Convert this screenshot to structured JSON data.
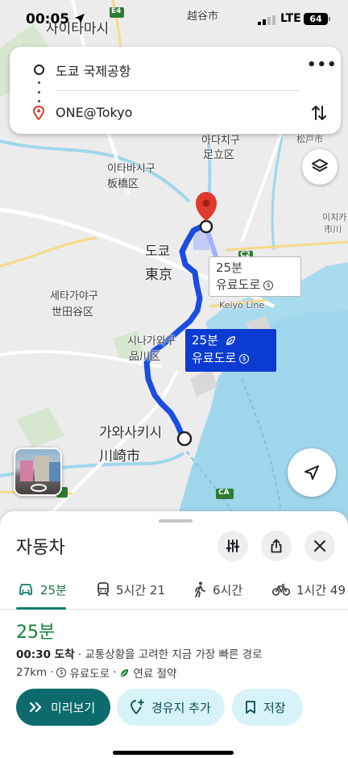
{
  "status_bar": {
    "time": "00:05",
    "network": "LTE",
    "battery": "64"
  },
  "route_card": {
    "origin": "도쿄 국제공항",
    "destination": "ONE@Tokyo",
    "more_label": "•••"
  },
  "map": {
    "labels": {
      "saitama": "사이타마시",
      "koshigaya": "越谷市",
      "adachi_ko": "아다치구",
      "adachi_ja": "足立区",
      "matsudo": "松戸市",
      "itabashi_ko": "이타바시구",
      "itabashi_ja": "板橋区",
      "tokyo_ko": "도쿄",
      "tokyo_ja": "東京",
      "setagaya_ko": "세타가야구",
      "setagaya_ja": "世田谷区",
      "shinagawa_ko": "시나가와구",
      "shinagawa_ja": "品川区",
      "kawasaki_ko": "가와사키시",
      "kawasaki_ja": "川崎市",
      "ichikawa_ko": "이치카",
      "ichikawa_ja": "市川",
      "keiyo_line": "Keiyo Line",
      "shield_e4": "E4",
      "shield_c2": "C2",
      "shield_ca": "CA"
    },
    "callout_alt": {
      "time": "25분",
      "note": "유료도로"
    },
    "callout_main": {
      "time": "25분",
      "note": "유료도로"
    }
  },
  "sheet": {
    "title": "자동차",
    "tabs": [
      {
        "icon": "car-icon",
        "label": "25분"
      },
      {
        "icon": "transit-icon",
        "label": "5시간 21"
      },
      {
        "icon": "walk-icon",
        "label": "6시간"
      },
      {
        "icon": "bike-icon",
        "label": "1시간 49"
      }
    ],
    "duration": "25분",
    "arrival_time": "00:30 도착",
    "arrival_note": "· 교통상황을 고려한 지금 가장 빠른 경로",
    "distance": "27km",
    "separator": "·",
    "toll_label": "유료도로",
    "fuel_label": "연료 절약",
    "buttons": {
      "preview": "미리보기",
      "add_waypoint": "경유지 추가",
      "save": "저장"
    }
  },
  "colors": {
    "route_main": "#1a4de0",
    "route_alt": "#9fb2ff",
    "water": "#9fd6ec",
    "accent_green": "#188038",
    "preview_button": "#0d6b6d",
    "secondary_button": "#d7f3f8",
    "destination_pin": "#e03a2f"
  }
}
